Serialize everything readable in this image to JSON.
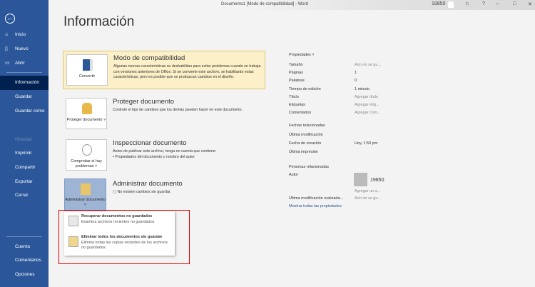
{
  "titlebar": {
    "title": "Documento1 [Modo de compatibilidad] - Word",
    "user": "19850",
    "help": "?",
    "minimize": "–",
    "maximize": "□",
    "close": "✕"
  },
  "sidebar": {
    "items": [
      {
        "label": "Inicio",
        "icon": "⌂"
      },
      {
        "label": "Nuevo",
        "icon": "▯"
      },
      {
        "label": "Abrir",
        "icon": "▭"
      },
      {
        "label": "Información"
      },
      {
        "label": "Guardar"
      },
      {
        "label": "Guardar como"
      },
      {
        "label": "Historial"
      },
      {
        "label": "Imprimir"
      },
      {
        "label": "Compartir"
      },
      {
        "label": "Exportar"
      },
      {
        "label": "Cerrar"
      },
      {
        "label": "Cuenta"
      },
      {
        "label": "Comentarios"
      },
      {
        "label": "Opciones"
      }
    ]
  },
  "page_title": "Información",
  "cards": [
    {
      "button": "Convertir",
      "title": "Modo de compatibilidad",
      "desc": "Algunas nuevas características se deshabilitan para evitar problemas cuando se trabaja con versiones anteriores de Office. Si se convierte este archivo, se habilitarán estas características, pero es posible que se produzcan cambios en el diseño."
    },
    {
      "button": "Proteger documento ˅",
      "title": "Proteger documento",
      "desc": "Controle el tipo de cambios que los demás pueden hacer en este documento."
    },
    {
      "button": "Comprobar si hay problemas ˅",
      "title": "Inspeccionar documento",
      "desc": "Antes de publicar este archivo, tenga en cuenta que contiene:",
      "bullet": "Propiedades del documento y nombre del autor"
    },
    {
      "button": "Administrar documento ˅",
      "title": "Administrar documento",
      "desc": "No existen cambios sin guardar."
    }
  ],
  "menu": [
    {
      "title": "Recuperar documentos no guardados",
      "desc": "Examina archivos recientes no guardados"
    },
    {
      "title": "Eliminar todos los documentos sin guardar",
      "desc": "Elimina todas las copias recientes de los archivos no guardados."
    }
  ],
  "properties": {
    "header": "Propiedades ˅",
    "rows": [
      [
        "Tamaño",
        "Aún no se gu..."
      ],
      [
        "Páginas",
        "1"
      ],
      [
        "Palabras",
        "0"
      ],
      [
        "Tiempo de edición",
        "1 minuto"
      ],
      [
        "Título",
        "Agregar título"
      ],
      [
        "Etiquetas",
        "Agregar etiq..."
      ],
      [
        "Comentarios",
        "Agregar com..."
      ]
    ]
  },
  "dates": {
    "header": "Fechas relacionadas",
    "rows": [
      [
        "Última modificación",
        ""
      ],
      [
        "Fecha de creación",
        "Hoy, 1:50 pm"
      ],
      [
        "Última impresión",
        ""
      ]
    ]
  },
  "people": {
    "header": "Personas relacionadas",
    "author_label": "Autor",
    "author": "19850",
    "add_author": "Agregar un a...",
    "last_mod_label": "Última modificación realizada...",
    "last_mod": "Aún no se gu...",
    "show_all": "Mostrar todas las propiedades"
  }
}
